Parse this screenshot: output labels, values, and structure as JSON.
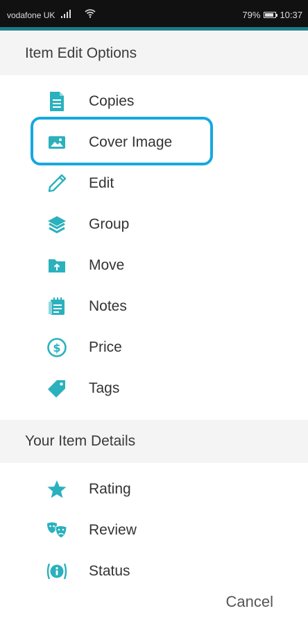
{
  "status_bar": {
    "carrier": "vodafone UK",
    "battery": "79%",
    "time": "10:37"
  },
  "colors": {
    "accent": "#2ab1bd",
    "highlight": "#16a8df",
    "header_bg": "#f4f4f4"
  },
  "sections": {
    "edit_options": {
      "title": "Item Edit Options",
      "items": [
        {
          "label": "Copies",
          "icon": "document-icon"
        },
        {
          "label": "Cover Image",
          "icon": "image-icon"
        },
        {
          "label": "Edit",
          "icon": "pencil-icon"
        },
        {
          "label": "Group",
          "icon": "layers-icon"
        },
        {
          "label": "Move",
          "icon": "folder-move-icon"
        },
        {
          "label": "Notes",
          "icon": "notes-icon"
        },
        {
          "label": "Price",
          "icon": "dollar-circle-icon"
        },
        {
          "label": "Tags",
          "icon": "tag-icon"
        }
      ]
    },
    "item_details": {
      "title": "Your Item Details",
      "items": [
        {
          "label": "Rating",
          "icon": "star-icon"
        },
        {
          "label": "Review",
          "icon": "masks-icon"
        },
        {
          "label": "Status",
          "icon": "info-icon"
        }
      ]
    }
  },
  "cancel_label": "Cancel"
}
